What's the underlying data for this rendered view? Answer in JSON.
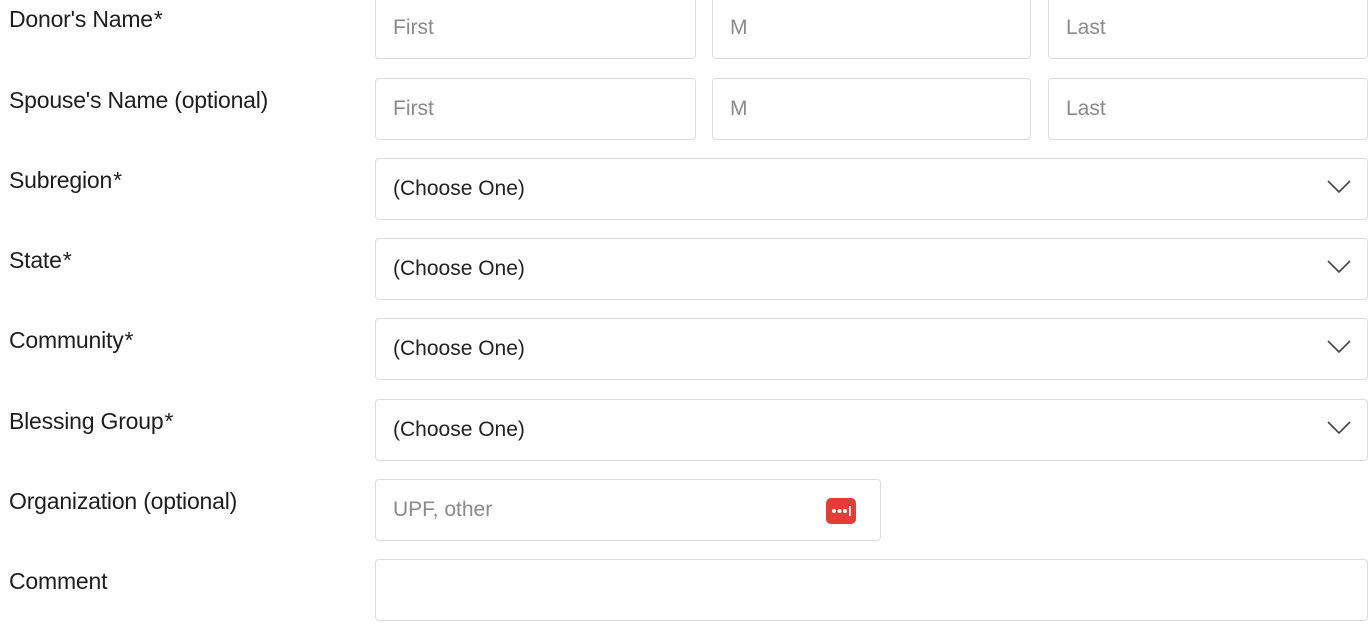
{
  "form": {
    "donor_name": {
      "label": "Donor's Name",
      "required_mark": "*",
      "first_placeholder": "First",
      "middle_placeholder": "M",
      "last_placeholder": "Last"
    },
    "spouse_name": {
      "label": "Spouse's Name (optional)",
      "first_placeholder": "First",
      "middle_placeholder": "M",
      "last_placeholder": "Last"
    },
    "subregion": {
      "label": "Subregion",
      "required_mark": "*",
      "selected": "(Choose One)"
    },
    "state": {
      "label": "State",
      "required_mark": "*",
      "selected": "(Choose One)"
    },
    "community": {
      "label": "Community",
      "required_mark": "*",
      "selected": "(Choose One)"
    },
    "blessing_group": {
      "label": "Blessing Group",
      "required_mark": "*",
      "selected": "(Choose One)"
    },
    "organization": {
      "label": "Organization (optional)",
      "placeholder": "UPF, other",
      "password_manager_icon": "password-manager-icon",
      "password_manager_color": "#e03e36"
    },
    "comment": {
      "label": "Comment",
      "value": ""
    }
  },
  "icons": {
    "dropdown": "chevron-down-icon"
  },
  "colors": {
    "border": "#dcdcdc",
    "text": "#1d1d1d",
    "placeholder": "#8a8a8a"
  }
}
